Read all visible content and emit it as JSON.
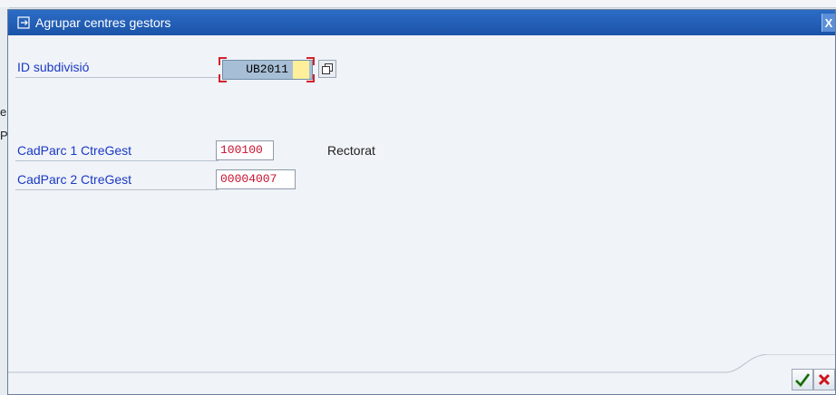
{
  "background": {
    "fragments": [
      "e",
      "P"
    ]
  },
  "dialog": {
    "title": "Agrupar centres gestors",
    "title_icon": "window-enter-icon",
    "close_glyph": "X"
  },
  "form": {
    "subdivision": {
      "label": "ID subdivisió",
      "value": "UB2011"
    },
    "cadparc1": {
      "label": "CadParc 1 CtreGest",
      "value": "100100",
      "description": "Rectorat"
    },
    "cadparc2": {
      "label": "CadParc 2 CtreGest",
      "value": "00004007"
    }
  },
  "footer": {
    "confirm_icon": "check-icon",
    "cancel_icon": "cancel-icon"
  },
  "colors": {
    "title_bar": "#1f5bb3",
    "label": "#1a39c4",
    "value_red": "#c8102e",
    "confirm": "#2fa11e",
    "cancel": "#d1141c"
  }
}
